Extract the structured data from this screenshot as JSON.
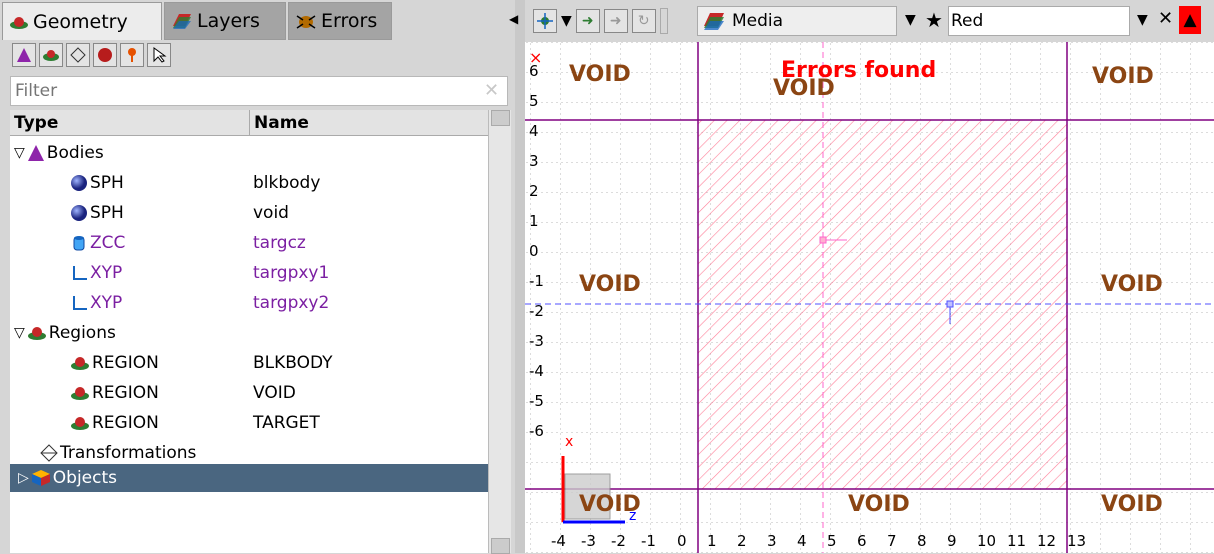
{
  "tabs": [
    {
      "label": "Geometry",
      "icon": "geometry-icon"
    },
    {
      "label": "Layers",
      "icon": "layers-icon"
    },
    {
      "label": "Errors",
      "icon": "errors-icon"
    }
  ],
  "filter": {
    "placeholder": "Filter"
  },
  "columns": {
    "type": "Type",
    "name": "Name"
  },
  "tree": {
    "bodies": {
      "label": "Bodies"
    },
    "body_items": [
      {
        "type": "SPH",
        "name": "blkbody"
      },
      {
        "type": "SPH",
        "name": "void"
      },
      {
        "type": "ZCC",
        "name": "targcz"
      },
      {
        "type": "XYP",
        "name": "targpxy1"
      },
      {
        "type": "XYP",
        "name": "targpxy2"
      }
    ],
    "regions": {
      "label": "Regions"
    },
    "region_items": [
      {
        "type": "REGION",
        "name": "BLKBODY"
      },
      {
        "type": "REGION",
        "name": "VOID"
      },
      {
        "type": "REGION",
        "name": "TARGET"
      }
    ],
    "transformations": {
      "label": "Transformations"
    },
    "objects": {
      "label": "Objects"
    }
  },
  "viewer_toolbar": {
    "media_label": "Media",
    "color_value": "Red"
  },
  "canvas": {
    "errors_label": "Errors found",
    "void_label": "VOID",
    "y_ticks": [
      "6",
      "5",
      "4",
      "3",
      "2",
      "1",
      "0",
      "-1",
      "-2",
      "-3",
      "-4",
      "-5",
      "-6"
    ],
    "x_ticks": [
      "-4",
      "-3",
      "-2",
      "-1",
      "0",
      "1",
      "2",
      "3",
      "4",
      "5",
      "6",
      "7",
      "8",
      "9",
      "10",
      "11",
      "12",
      "13"
    ],
    "axis_x": "x",
    "axis_z": "z"
  },
  "colors": {
    "region_line": "#800080",
    "hatch": "#ff6080",
    "void_text": "#8b4513",
    "selection": "#4a6680"
  }
}
